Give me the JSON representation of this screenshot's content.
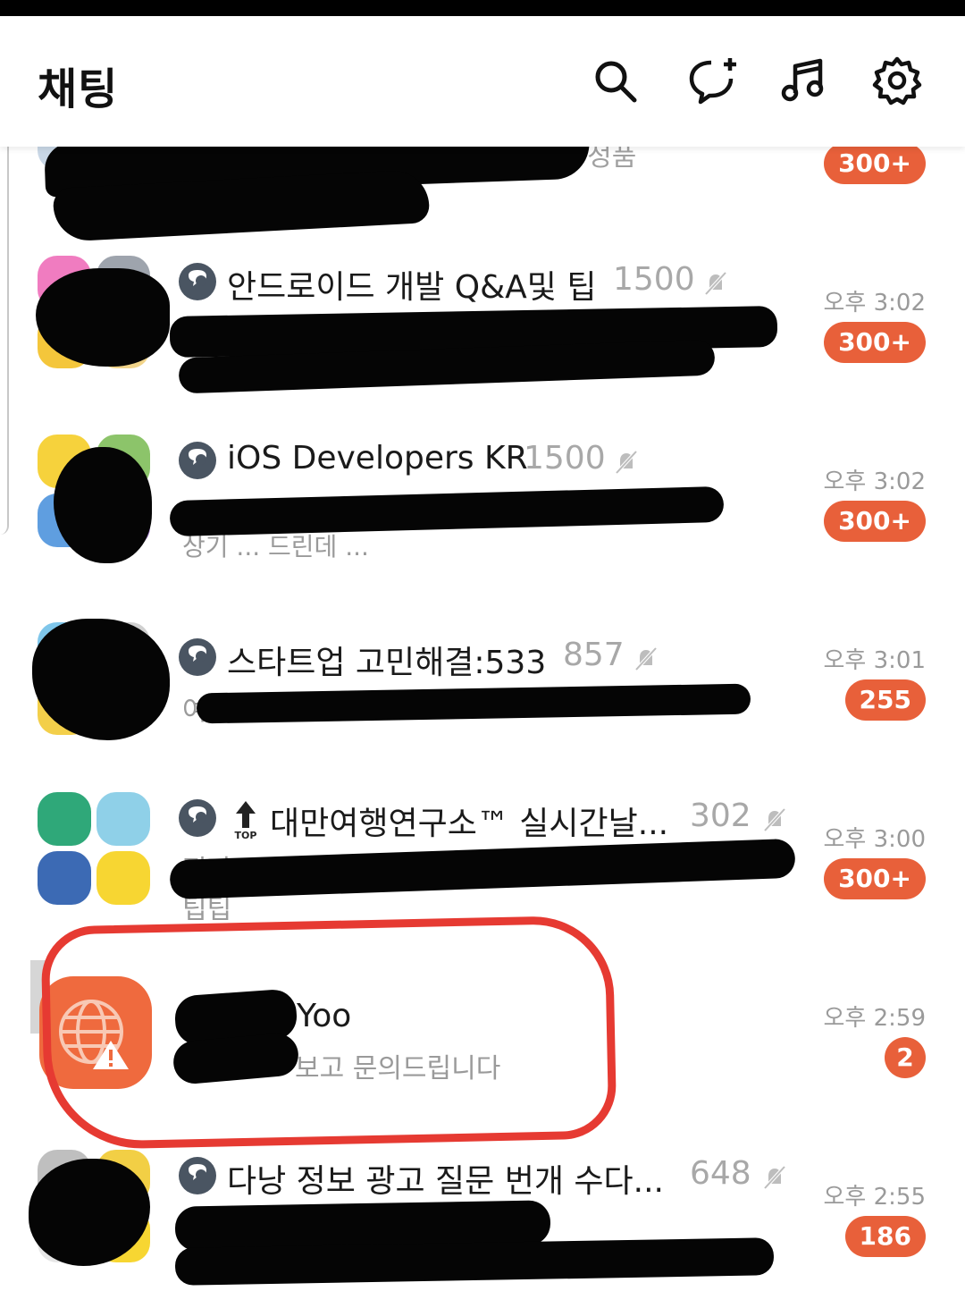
{
  "header": {
    "title": "채팅",
    "icons": [
      "search-icon",
      "new-chat-icon",
      "music-icon",
      "settings-icon"
    ]
  },
  "chats": [
    {
      "title": "",
      "preview": "고 정품",
      "time": "",
      "badge": "300+"
    },
    {
      "title": "안드로이드 개발 Q&A및 팁",
      "members": "1500",
      "preview": "",
      "time": "오후 3:02",
      "badge": "300+"
    },
    {
      "title": "iOS Developers KR",
      "members": "1500",
      "preview": "상기 ... 드린데 ...",
      "time": "오후 3:02",
      "badge": "300+"
    },
    {
      "title": "스타트업 고민해결:533",
      "members": "857",
      "preview": "여",
      "time": "오후 3:01",
      "badge": "255"
    },
    {
      "title": "대만여행연구소™ 실시간날...",
      "members": "302",
      "preview": "진짜",
      "preview2": "팁팁",
      "time": "오후 3:00",
      "badge": "300+"
    },
    {
      "title": "Yoo",
      "preview": "보고 문의드립니다",
      "time": "오후 2:59",
      "badge": "2"
    },
    {
      "title": "다낭 정보 광고 질문 번개 수다...",
      "members": "648",
      "preview": "",
      "time": "오후 2:55",
      "badge": "186"
    }
  ],
  "colors": {
    "badge": "#e8603a",
    "annotation": "#e63a32",
    "app_icon": "#ef6a3e"
  }
}
